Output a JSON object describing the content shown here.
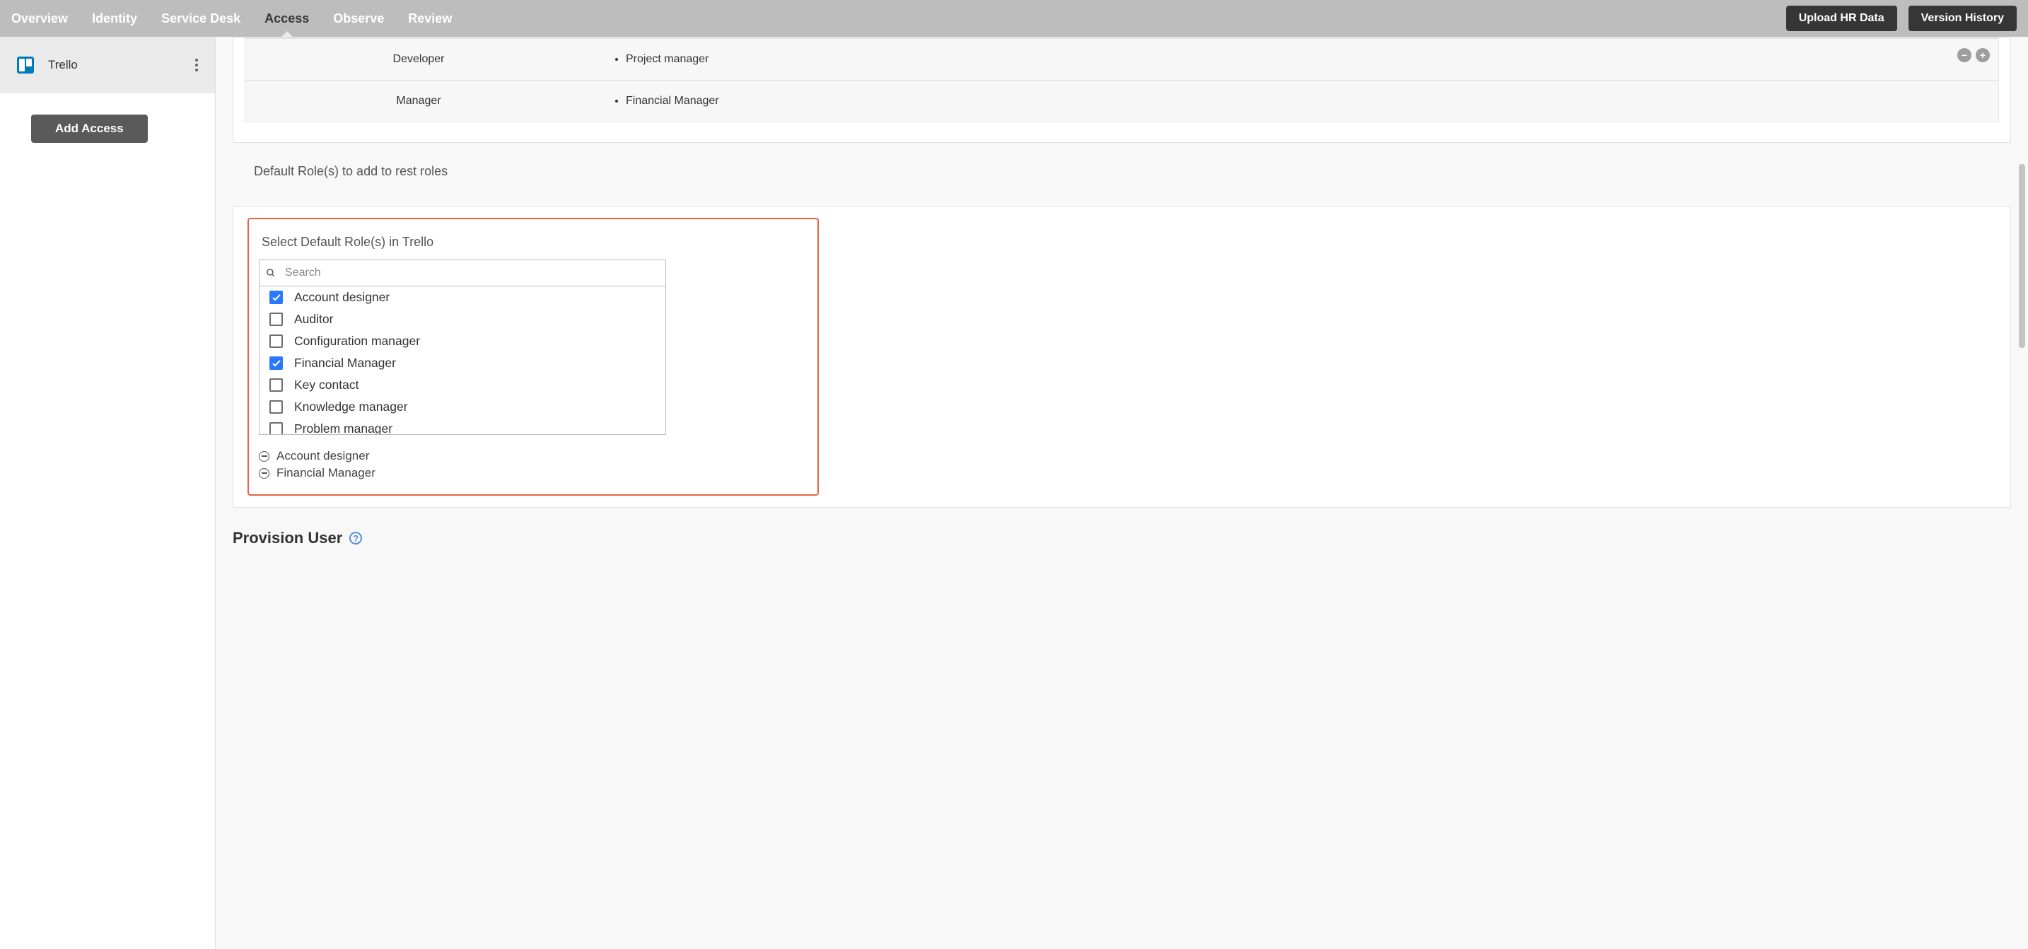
{
  "nav": {
    "items": [
      {
        "label": "Overview"
      },
      {
        "label": "Identity"
      },
      {
        "label": "Service Desk"
      },
      {
        "label": "Access",
        "active": true
      },
      {
        "label": "Observe"
      },
      {
        "label": "Review"
      }
    ],
    "actions": {
      "upload": "Upload HR Data",
      "history": "Version History"
    }
  },
  "sidebar": {
    "app_label": "Trello",
    "add_access": "Add Access"
  },
  "mapping": {
    "rows": [
      {
        "role": "Developer",
        "mapped": [
          "Project manager"
        ]
      },
      {
        "role": "Manager",
        "mapped": [
          "Financial Manager"
        ]
      }
    ]
  },
  "default_roles": {
    "section_label": "Default Role(s) to add to rest roles",
    "title": "Select Default Role(s) in Trello",
    "search_placeholder": "Search",
    "options": [
      {
        "label": "Account designer",
        "checked": true
      },
      {
        "label": "Auditor",
        "checked": false
      },
      {
        "label": "Configuration manager",
        "checked": false
      },
      {
        "label": "Financial Manager",
        "checked": true
      },
      {
        "label": "Key contact",
        "checked": false
      },
      {
        "label": "Knowledge manager",
        "checked": false
      },
      {
        "label": "Problem manager",
        "checked": false
      }
    ],
    "selected": [
      {
        "label": "Account designer"
      },
      {
        "label": "Financial Manager"
      }
    ]
  },
  "provision": {
    "title": "Provision User"
  }
}
